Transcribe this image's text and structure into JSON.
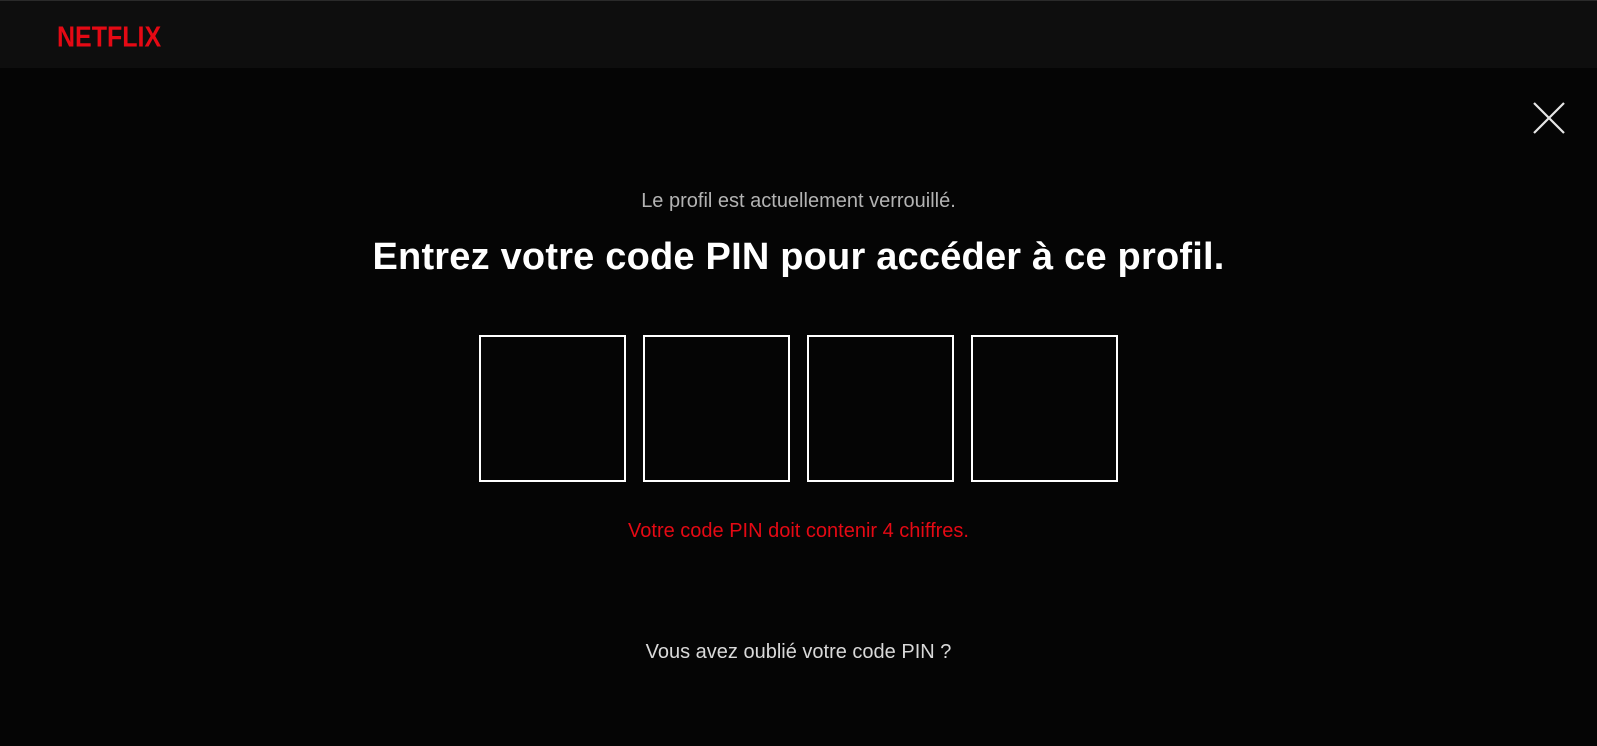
{
  "header": {
    "logo_text": "NETFLIX",
    "brand_color": "#e50914"
  },
  "close_button": {
    "icon": "close-icon"
  },
  "main": {
    "subtitle": "Le profil est actuellement verrouillé.",
    "heading": "Entrez votre code PIN pour accéder à ce profil.",
    "pin_fields": [
      "",
      "",
      "",
      ""
    ],
    "error_message": "Votre code PIN doit contenir 4 chiffres.",
    "error_color": "#e50914",
    "forgot_link": "Vous avez oublié votre code PIN ?"
  }
}
